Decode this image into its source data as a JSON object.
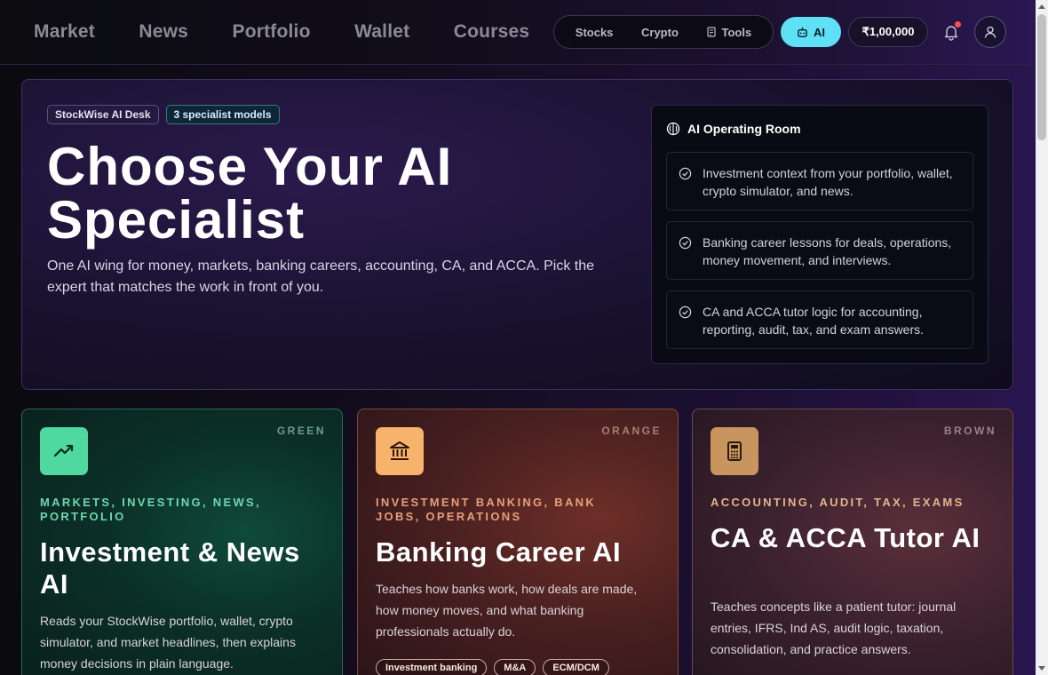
{
  "nav": {
    "links": [
      "Market",
      "News",
      "Portfolio",
      "Wallet",
      "Courses"
    ],
    "segment": {
      "stocks": "Stocks",
      "crypto": "Crypto",
      "tools": "Tools"
    },
    "ai_label": "AI",
    "balance": "₹1,00,000"
  },
  "hero": {
    "pills": [
      "StockWise AI Desk",
      "3 specialist models"
    ],
    "title": "Choose Your AI Specialist",
    "subtitle": "One AI wing for money, markets, banking careers, accounting, CA, and ACCA. Pick the expert that matches the work in front of you.",
    "operating_room": {
      "title": "AI Operating Room",
      "items": [
        "Investment context from your portfolio, wallet, crypto simulator, and news.",
        "Banking career lessons for deals, operations, money movement, and interviews.",
        "CA and ACCA tutor logic for accounting, reporting, audit, tax, and exam answers."
      ]
    }
  },
  "cards": [
    {
      "color_label": "GREEN",
      "tag": "Markets, investing, news, portfolio",
      "title": "Investment & News AI",
      "desc": "Reads your StockWise portfolio, wallet, crypto simulator, and market headlines, then explains money decisions in plain language."
    },
    {
      "color_label": "ORANGE",
      "tag": "Investment banking, bank jobs, operations",
      "title": "Banking Career AI",
      "desc": "Teaches how banks work, how deals are made, how money moves, and what banking professionals actually do.",
      "chips": [
        "Investment banking",
        "M&A",
        "ECM/DCM"
      ]
    },
    {
      "color_label": "BROWN",
      "tag": "Accounting, audit, tax, exams",
      "title": "CA & ACCA Tutor AI",
      "desc": "Teaches concepts like a patient tutor: journal entries, IFRS, Ind AS, audit logic, taxation, consolidation, and practice answers."
    }
  ],
  "colors": {
    "accent_cyan": "#5ee0f5",
    "green": "#4fd9a0",
    "orange": "#f7b36c",
    "brown": "#c8955f",
    "notification": "#ff4d4d"
  },
  "icons": [
    "bar-chart-icon",
    "coin-icon",
    "tool-icon",
    "robot-icon",
    "bell-icon",
    "user-icon",
    "brain-icon",
    "check-circle-icon",
    "trend-up-icon",
    "bank-icon",
    "calculator-icon"
  ]
}
